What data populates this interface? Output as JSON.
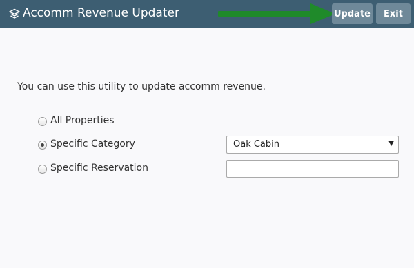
{
  "header": {
    "title": "Accomm Revenue Updater",
    "title_icon": "layers-icon",
    "update_label": "Update",
    "exit_label": "Exit",
    "annotation_arrow_color": "#1f8a2a",
    "bar_color": "#3d5e72",
    "button_color": "#6f8999"
  },
  "main": {
    "intro": "You can use this utility to update accomm revenue.",
    "options": [
      {
        "label": "All Properties",
        "selected": false
      },
      {
        "label": "Specific Category",
        "selected": true
      },
      {
        "label": "Specific Reservation",
        "selected": false
      }
    ],
    "category_select": {
      "value": "Oak Cabin"
    },
    "reservation_input": {
      "value": "",
      "placeholder": ""
    }
  }
}
